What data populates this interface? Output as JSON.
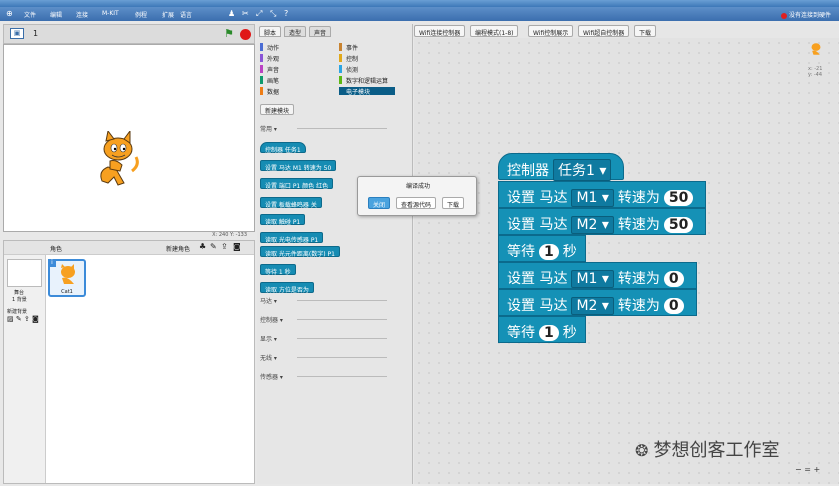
{
  "menu": {
    "items": [
      "文件",
      "编辑",
      "连接",
      "M-KIT",
      "例程",
      "扩展",
      "语言"
    ],
    "connection": "没有连接到硬件"
  },
  "stage": {
    "sprite_number": "1",
    "coords": "X: 240  Y: -133"
  },
  "sprites": {
    "header": "角色",
    "new_sprite": "新建角色",
    "stage_label": "舞台",
    "stage_sub": "1 背景",
    "new_bg": "新建背景",
    "sprite_name": "Cat1"
  },
  "palette": {
    "tabs": [
      "脚本",
      "造型",
      "声音"
    ],
    "categories": [
      {
        "label": "动作",
        "color": "#4a6cd4"
      },
      {
        "label": "事件",
        "color": "#c88330"
      },
      {
        "label": "外观",
        "color": "#8a55d7"
      },
      {
        "label": "控制",
        "color": "#e1a91a"
      },
      {
        "label": "声音",
        "color": "#bb42c3"
      },
      {
        "label": "侦测",
        "color": "#2ca5e2"
      },
      {
        "label": "画笔",
        "color": "#0e9a6c"
      },
      {
        "label": "数字和逻辑运算",
        "color": "#5cb712"
      },
      {
        "label": "数据",
        "color": "#ee7d16"
      },
      {
        "label": "电子模块",
        "color": "#0a5d87"
      }
    ],
    "make_block": "新建模块",
    "section_common": "常用",
    "blocks": [
      "控制器 任务1",
      "设置 马达 M1 转速为 50",
      "设置 端口 P1 颜色 红色",
      "设置 板载蜂鸣器 关",
      "读取 触碰 P1",
      "读取 光电传感器 P1",
      "读取 光元件距离(数字) P1",
      "等待 1 秒",
      "读取 方位是否为"
    ],
    "sections": [
      "马达",
      "控制器",
      "显示",
      "无线",
      "传感器"
    ]
  },
  "toolbar": {
    "buttons": [
      "Wifi连接控制器",
      "编程模式(1-8)",
      "Wifi控制展示",
      "Wifi超自控制器",
      "下载"
    ]
  },
  "dialog": {
    "title": "编译成功",
    "buttons": [
      "关闭",
      "查看源代码",
      "下载"
    ]
  },
  "script": {
    "blocks": [
      {
        "kind": "hat",
        "parts": [
          {
            "t": "text",
            "v": "控制器"
          },
          {
            "t": "dd",
            "v": "任务1"
          }
        ]
      },
      {
        "parts": [
          {
            "t": "text",
            "v": "设置 马达"
          },
          {
            "t": "dd",
            "v": "M1"
          },
          {
            "t": "text",
            "v": "转速为"
          },
          {
            "t": "num",
            "v": "50"
          }
        ]
      },
      {
        "parts": [
          {
            "t": "text",
            "v": "设置 马达"
          },
          {
            "t": "dd",
            "v": "M2"
          },
          {
            "t": "text",
            "v": "转速为"
          },
          {
            "t": "num",
            "v": "50"
          }
        ]
      },
      {
        "parts": [
          {
            "t": "text",
            "v": "等待"
          },
          {
            "t": "num",
            "v": "1"
          },
          {
            "t": "text",
            "v": "秒"
          }
        ]
      },
      {
        "parts": [
          {
            "t": "text",
            "v": "设置 马达"
          },
          {
            "t": "dd",
            "v": "M1"
          },
          {
            "t": "text",
            "v": "转速为"
          },
          {
            "t": "num",
            "v": "0"
          }
        ]
      },
      {
        "parts": [
          {
            "t": "text",
            "v": "设置 马达"
          },
          {
            "t": "dd",
            "v": "M2"
          },
          {
            "t": "text",
            "v": "转速为"
          },
          {
            "t": "num",
            "v": "0"
          }
        ]
      },
      {
        "parts": [
          {
            "t": "text",
            "v": "等待"
          },
          {
            "t": "num",
            "v": "1"
          },
          {
            "t": "text",
            "v": "秒"
          }
        ]
      }
    ],
    "sprite_coords": "x: -21\ny: -44"
  },
  "watermark": "梦想创客工作室",
  "zoom": [
    "−",
    "=",
    "+"
  ]
}
